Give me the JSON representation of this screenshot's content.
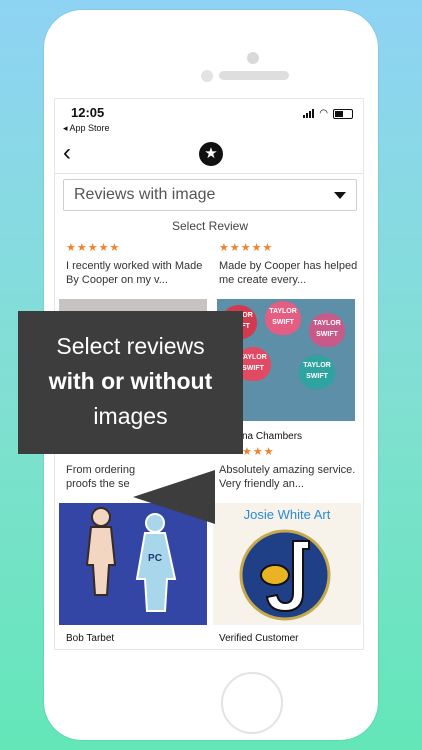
{
  "status_bar": {
    "time": "12:05",
    "back_app": "App Store"
  },
  "filter": {
    "value": "Reviews with image",
    "caption": "Select Review"
  },
  "reviews": [
    {
      "stars": "★★★★★",
      "text": "I recently worked with Made By Cooper on my v..."
    },
    {
      "stars": "★★★★★",
      "text": "Made by Cooper has helped me create every..."
    },
    {
      "name": "na Chambers",
      "stars": "★★★"
    },
    {
      "text": "From ordering proofs the se"
    },
    {
      "text": "Absolutely amazing service. Very friendly an..."
    },
    {
      "name": "Bob Tarbet"
    },
    {
      "name": "Verified Customer"
    }
  ],
  "images": {
    "pin_text_taylor": [
      "TAYLOR SWIFT",
      "TAYLOR SWIFT",
      "TAYLOR SWIFT",
      "TAYLOR SWIFT",
      "TAYLOR SWIFT"
    ],
    "pin_initials": "PC",
    "josie_title": "Josie White Art"
  },
  "overlay": {
    "line1": "Select reviews",
    "line2": "with or without",
    "line3": "images"
  },
  "colors": {
    "star": "#f0822e",
    "overlay": "#3d3d3d"
  }
}
